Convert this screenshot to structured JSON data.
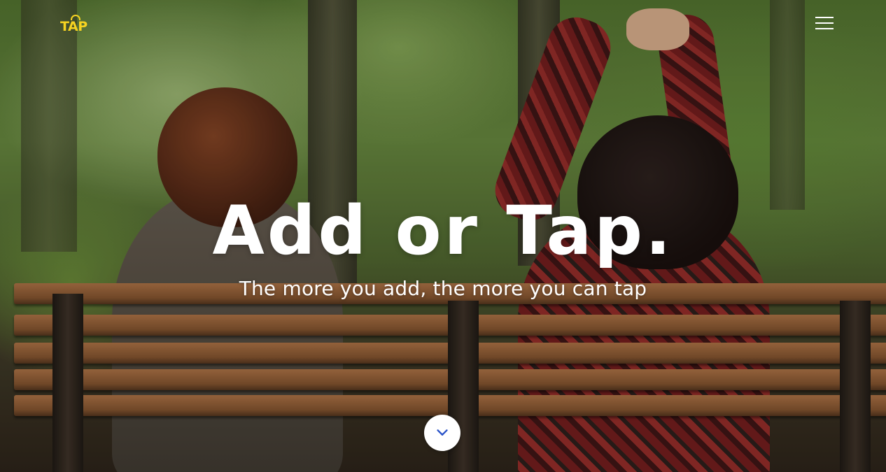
{
  "header": {
    "logo_text": "TAP",
    "logo_color": "#f6d321",
    "menu_icon": "hamburger-menu-icon"
  },
  "hero": {
    "title": "Add or Tap.",
    "subtitle": "The more you add, the more you can tap",
    "background_image": "two-people-on-park-bench",
    "scroll_icon": "chevron-down-icon",
    "accent_color": "#2b54c9"
  }
}
